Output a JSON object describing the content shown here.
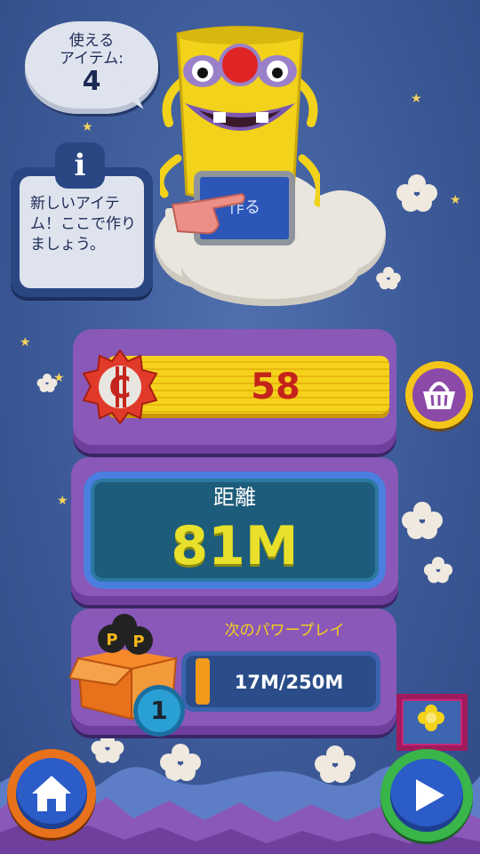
{
  "hud": {
    "items_label": "使えるアイテム:",
    "items_label_line1": "使える",
    "items_label_line2": "アイテム:",
    "items_count": "4"
  },
  "tip": {
    "icon": "i",
    "text": "新しいアイテム！ここで作りましょう。"
  },
  "craft": {
    "button_label": "作る"
  },
  "coins": {
    "value": "58"
  },
  "distance": {
    "label": "距離",
    "value": "81M"
  },
  "powerplay": {
    "label": "次のパワープレイ",
    "progress_text": "17M/250M",
    "progress_fraction": 0.068,
    "box_count": "1"
  },
  "icons": {
    "home": "home-icon",
    "play": "play-icon",
    "shop": "basket-icon",
    "coin": "coin-icon"
  },
  "colors": {
    "background": "#3d5a98",
    "board": "#8a58b8",
    "coin_bar": "#f5d21c",
    "coin_text": "#c4241c",
    "distance_value": "#e8e02a",
    "home_ring": "#e8711c",
    "play_ring": "#39b54a"
  }
}
